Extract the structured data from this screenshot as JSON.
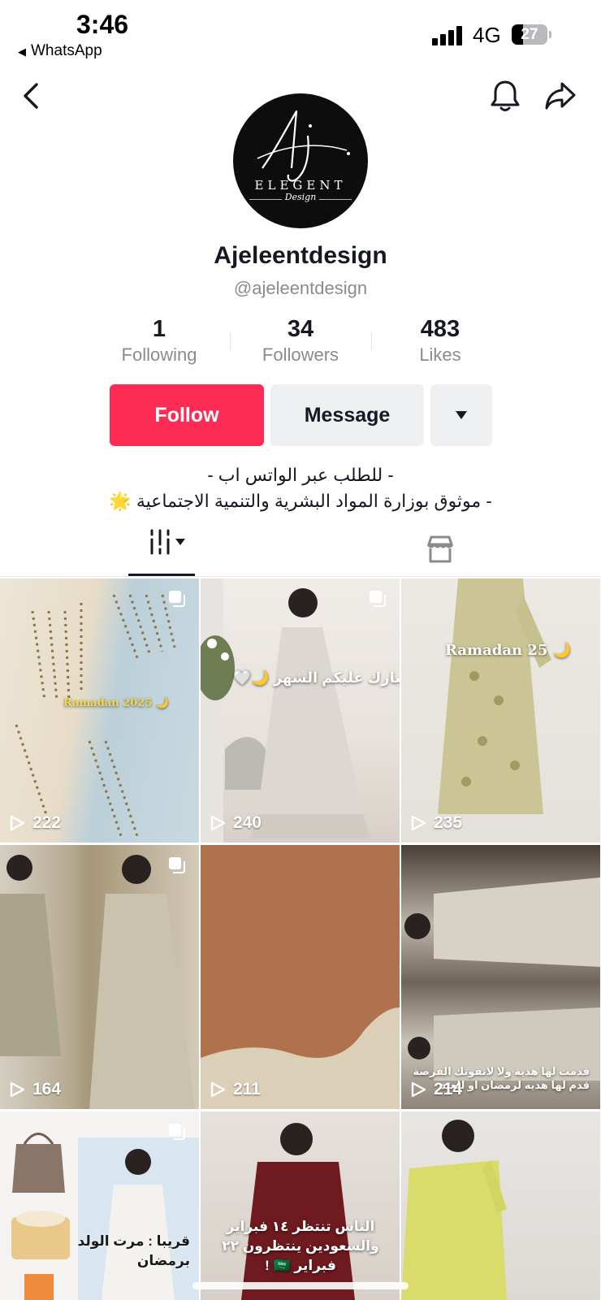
{
  "status_bar": {
    "time": "3:46",
    "back_app": "WhatsApp",
    "network": "4G",
    "battery": "27"
  },
  "profile": {
    "display_name": "Ajeleentdesign",
    "handle": "@ajeleentdesign",
    "logo_lines": [
      "Aj",
      "ELEGENT",
      "Design"
    ],
    "stats": [
      {
        "value": "1",
        "label": "Following"
      },
      {
        "value": "34",
        "label": "Followers"
      },
      {
        "value": "483",
        "label": "Likes"
      }
    ],
    "follow_label": "Follow",
    "message_label": "Message",
    "bio": [
      "- للطلب عبر الواتس اب -",
      "- موثوق بوزارة المواد البشرية والتنمية الاجتماعية 🌟"
    ]
  },
  "videos": [
    {
      "views": "222",
      "caption": "Ramadan 2025 🌙",
      "multi": true
    },
    {
      "views": "240",
      "caption": "مبارك عليكم الشهر 🌙🤍",
      "multi": true
    },
    {
      "views": "235",
      "caption": "Ramadan 25 🌙",
      "multi": false
    },
    {
      "views": "164",
      "caption": "",
      "multi": true
    },
    {
      "views": "211",
      "caption": "",
      "multi": false
    },
    {
      "views": "214",
      "caption": "قدمت لها هدية ولا لاتفوتك الفرصة قدم لها هديه لرمضان او للعيد",
      "multi": false
    },
    {
      "views": "",
      "caption": "قريبا : مرت الولد برمضان",
      "multi": true
    },
    {
      "views": "",
      "caption": "الناس تنتظر ١٤ فبراير والسعودين ينتظرون ٢٢ فبراير 🇸🇦 !",
      "multi": false
    },
    {
      "views": "",
      "caption": "",
      "multi": false
    }
  ],
  "colors": {
    "follow": "#fe2c55",
    "secondary_button": "#eff0f1",
    "muted_text": "#8a8b91"
  }
}
